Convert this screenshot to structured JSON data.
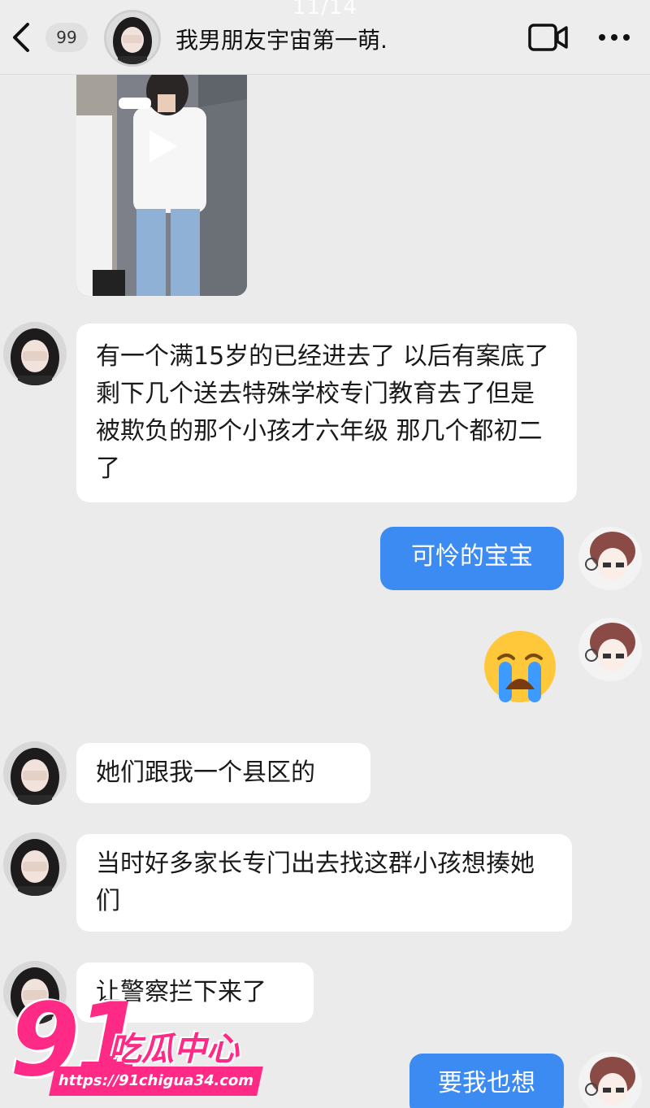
{
  "viewer": {
    "counter": "11/14"
  },
  "header": {
    "unread_count": "99",
    "contact_name": "我男朋友宇宙第一萌."
  },
  "messages": [
    {
      "side": "in",
      "text": "有一个满15岁的已经进去了 以后有案底了 剩下几个送去特殊学校专门教育去了但是被欺负的那个小孩才六年级 那几个都初二了"
    },
    {
      "side": "out",
      "text": "可怜的宝宝"
    },
    {
      "side": "out",
      "emoji": "loudly-crying-face"
    },
    {
      "side": "in",
      "text": "她们跟我一个县区的"
    },
    {
      "side": "in",
      "text": "当时好多家长专门出去找这群小孩想揍她们"
    },
    {
      "side": "in",
      "text": "让警察拦下来了"
    },
    {
      "side": "out",
      "text": "要我也想"
    }
  ],
  "watermark": {
    "number": "91",
    "brand": "吃瓜中心",
    "url": "https://91chigua34.com"
  },
  "colors": {
    "bubble_out": "#3c8bf2",
    "bubble_in": "#ffffff",
    "background": "#ebebeb",
    "watermark": "#ff2a86"
  }
}
